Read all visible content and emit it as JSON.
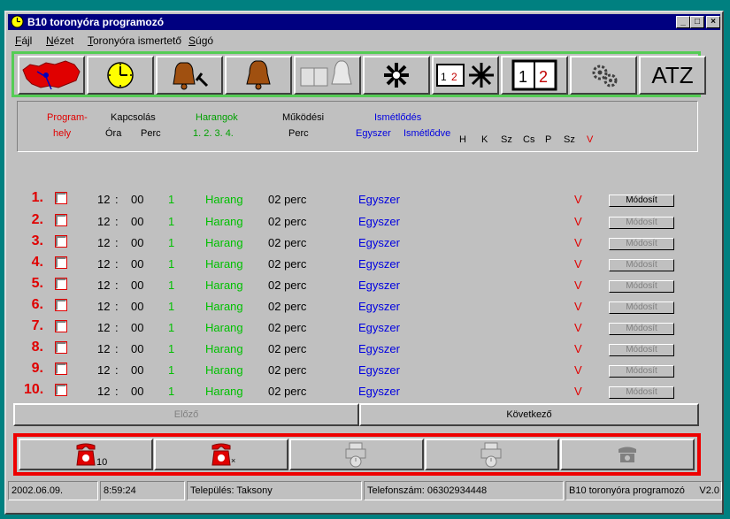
{
  "window": {
    "title": "B10 toronyóra programozó"
  },
  "menu": [
    {
      "key": "F",
      "rest": "ájl"
    },
    {
      "key": "N",
      "rest": "ézet"
    },
    {
      "key": "T",
      "rest": "oronyóra ismertető"
    },
    {
      "key": "S",
      "rest": "úgó"
    }
  ],
  "toolbar": {
    "icons": [
      "hungary-map-icon",
      "clock-icon",
      "bell-hammer-icon",
      "bell-icon",
      "book-bell-icon",
      "snowflake-icon",
      "calendar-snowflake-icon",
      "calendar-icon",
      "gears-icon",
      "atz-icon"
    ],
    "atz_label": "ATZ"
  },
  "header": {
    "program_1": "Program-",
    "program_2": "hely",
    "kapcsolas": "Kapcsolás",
    "ora": "Óra",
    "perc": "Perc",
    "harangok": "Harangok",
    "harang_nums": "1.  2.  3.  4.",
    "mukodesi": "Működési",
    "mukodesi_perc": "Perc",
    "ismetlodes": "Ismétlődés",
    "egyszer": "Egyszer",
    "ismetlodve": "Ismétlődve",
    "days": [
      "H",
      "K",
      "Sz",
      "Cs",
      "P",
      "Sz",
      "V"
    ]
  },
  "rows": [
    {
      "num": "1.",
      "hour": "12",
      "sep": ":",
      "minute": "00",
      "bell": "1",
      "bell_name": "Harang",
      "duration": "02 perc",
      "repeat": "Egyszer",
      "day": "V",
      "button": "Módosít",
      "enabled": true
    },
    {
      "num": "2.",
      "hour": "12",
      "sep": ":",
      "minute": "00",
      "bell": "1",
      "bell_name": "Harang",
      "duration": "02 perc",
      "repeat": "Egyszer",
      "day": "V",
      "button": "Módosít",
      "enabled": false
    },
    {
      "num": "3.",
      "hour": "12",
      "sep": ":",
      "minute": "00",
      "bell": "1",
      "bell_name": "Harang",
      "duration": "02 perc",
      "repeat": "Egyszer",
      "day": "V",
      "button": "Módosít",
      "enabled": false
    },
    {
      "num": "4.",
      "hour": "12",
      "sep": ":",
      "minute": "00",
      "bell": "1",
      "bell_name": "Harang",
      "duration": "02 perc",
      "repeat": "Egyszer",
      "day": "V",
      "button": "Módosít",
      "enabled": false
    },
    {
      "num": "5.",
      "hour": "12",
      "sep": ":",
      "minute": "00",
      "bell": "1",
      "bell_name": "Harang",
      "duration": "02 perc",
      "repeat": "Egyszer",
      "day": "V",
      "button": "Módosít",
      "enabled": false
    },
    {
      "num": "6.",
      "hour": "12",
      "sep": ":",
      "minute": "00",
      "bell": "1",
      "bell_name": "Harang",
      "duration": "02 perc",
      "repeat": "Egyszer",
      "day": "V",
      "button": "Módosít",
      "enabled": false
    },
    {
      "num": "7.",
      "hour": "12",
      "sep": ":",
      "minute": "00",
      "bell": "1",
      "bell_name": "Harang",
      "duration": "02 perc",
      "repeat": "Egyszer",
      "day": "V",
      "button": "Módosít",
      "enabled": false
    },
    {
      "num": "8.",
      "hour": "12",
      "sep": ":",
      "minute": "00",
      "bell": "1",
      "bell_name": "Harang",
      "duration": "02 perc",
      "repeat": "Egyszer",
      "day": "V",
      "button": "Módosít",
      "enabled": false
    },
    {
      "num": "9.",
      "hour": "12",
      "sep": ":",
      "minute": "00",
      "bell": "1",
      "bell_name": "Harang",
      "duration": "02 perc",
      "repeat": "Egyszer",
      "day": "V",
      "button": "Módosít",
      "enabled": false
    },
    {
      "num": "10.",
      "hour": "12",
      "sep": ":",
      "minute": "00",
      "bell": "1",
      "bell_name": "Harang",
      "duration": "02 perc",
      "repeat": "Egyszer",
      "day": "V",
      "button": "Módosít",
      "enabled": false
    }
  ],
  "nav": {
    "prev": "Előző",
    "next": "Következő"
  },
  "bottom": {
    "dial_label": "10"
  },
  "status": {
    "date": "2002.06.09.",
    "time": "8:59:24",
    "town": "Település: Taksony",
    "phone": "Telefonszám: 06302934448",
    "app": "B10  toronyóra programozó",
    "version": "V2.0"
  },
  "colors": {
    "red": "#e00000",
    "green": "#00c000",
    "blue": "#0000e0",
    "disabled": "#808080"
  }
}
